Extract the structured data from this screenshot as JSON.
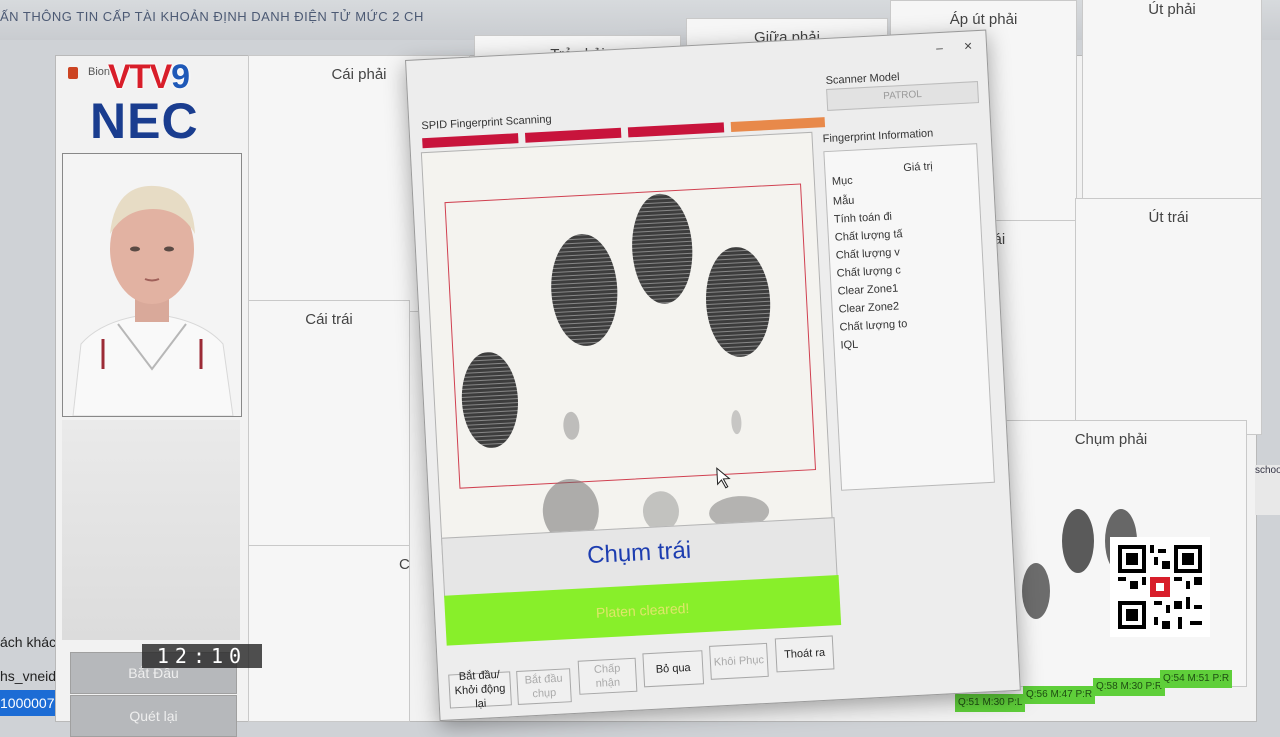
{
  "top_banner": {
    "text": "ẤN THÔNG TIN CẤP TÀI KHOẢN ĐỊNH DANH ĐIỆN TỬ MỨC 2 CH"
  },
  "main_window": {
    "title": "Bion"
  },
  "logos": {
    "vtv_text_a": "VTV",
    "vtv_text_b": "9",
    "nec_text": "NEC"
  },
  "finger_cells": {
    "cai_phai": "Cái phải",
    "tro_phai": "Trỏ phải",
    "giua_phai": "Giữa phải",
    "ap_ut_phai": "Áp út phải",
    "ut_phai": "Út phải",
    "cai_trai": "Cái trái",
    "ap_ut_trai_partial": "t trái",
    "ut_trai": "Út trái",
    "chum_phai": "Chụm phải",
    "partial_c": "C"
  },
  "sidebar": {
    "start_button": "Bắt Đầu",
    "exit_button": "Quét lại"
  },
  "left_edge": {
    "line1": "ách khách",
    "line2": "hs_vneid",
    "line3": "1000007"
  },
  "dialog": {
    "title": "SPID Fingerprint Scanning",
    "minimize": "–",
    "close": "×",
    "finger_name": "Chụm trái",
    "status": "Platen cleared!",
    "scanner_model_label": "Scanner Model",
    "scanner_model_value": "PATROL",
    "fingerprint_info_label": "Fingerprint Information",
    "info_headers": {
      "item": "Mục",
      "value": "Giá trị"
    },
    "info_rows": [
      "Mẫu",
      "Tính toán đi",
      "Chất lượng tấ",
      "Chất lượng v",
      "Chất lượng c",
      "Clear Zone1",
      "Clear Zone2",
      "Chất lượng to",
      "IQL"
    ],
    "buttons": {
      "start_restart": "Bắt đầu/ Khởi động lại",
      "start_capture": "Bắt đầu chụp",
      "accept": "Chấp nhận",
      "skip": "Bỏ qua",
      "restore": "Khôi Phục",
      "exit": "Thoát ra"
    },
    "progress_colors": [
      "#c8143c",
      "#c8143c",
      "#c8143c",
      "#e8894a"
    ]
  },
  "bottom_strip": [
    "Q:51 M:30 P:L",
    "Q:56 M:47 P:R",
    "Q:58 M:30 P:R",
    "Q:54 M:51 P:R"
  ],
  "right_edge": {
    "text": "schoo"
  },
  "clock": {
    "time": "12:10"
  }
}
